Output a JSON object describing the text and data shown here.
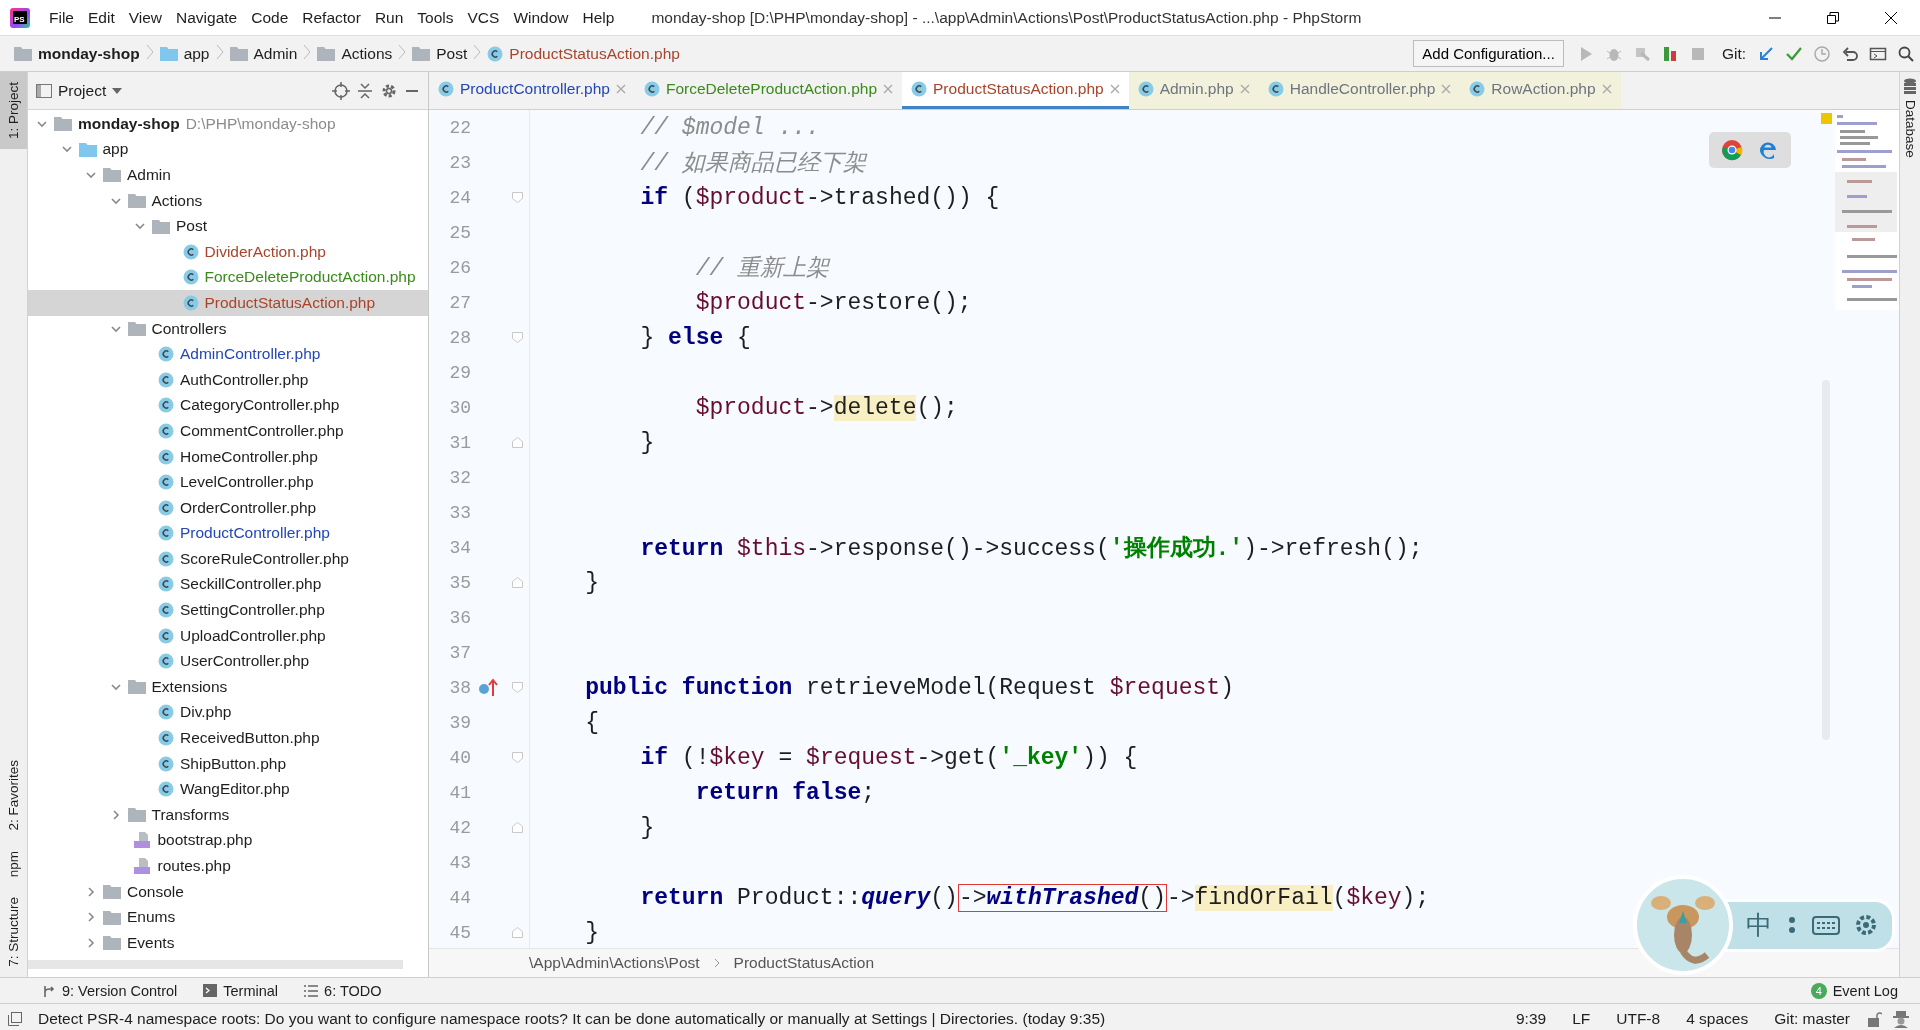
{
  "window": {
    "logo_text": "PS",
    "title": "monday-shop [D:\\PHP\\monday-shop] - ...\\app\\Admin\\Actions\\Post\\ProductStatusAction.php - PhpStorm"
  },
  "menu": [
    "File",
    "Edit",
    "View",
    "Navigate",
    "Code",
    "Refactor",
    "Run",
    "Tools",
    "VCS",
    "Window",
    "Help"
  ],
  "navbar": {
    "crumbs": [
      {
        "label": "monday-shop",
        "kind": "root"
      },
      {
        "label": "app",
        "kind": "source-folder"
      },
      {
        "label": "Admin",
        "kind": "folder"
      },
      {
        "label": "Actions",
        "kind": "folder"
      },
      {
        "label": "Post",
        "kind": "folder"
      },
      {
        "label": "ProductStatusAction.php",
        "kind": "class",
        "color": "#a9442a"
      }
    ],
    "run_config": "Add Configuration...",
    "git_label": "Git:"
  },
  "left_strip": [
    {
      "label": "1: Project",
      "selected": true
    },
    {
      "label": "2: Favorites",
      "selected": false
    },
    {
      "label": "npm",
      "selected": false
    },
    {
      "label": "7: Structure",
      "selected": false
    }
  ],
  "right_strip": [
    {
      "label": "Database"
    }
  ],
  "project": {
    "title": "Project",
    "tree": [
      {
        "label": "monday-shop",
        "path": "D:\\PHP\\monday-shop",
        "kind": "root",
        "expanded": true,
        "selected": false,
        "children": [
          {
            "label": "app",
            "kind": "source-folder",
            "expanded": true,
            "selected": false,
            "children": [
              {
                "label": "Admin",
                "kind": "folder",
                "expanded": true,
                "selected": false,
                "children": [
                  {
                    "label": "Actions",
                    "kind": "folder",
                    "expanded": true,
                    "selected": false,
                    "children": [
                      {
                        "label": "Post",
                        "kind": "folder",
                        "expanded": true,
                        "selected": false,
                        "children": [
                          {
                            "label": "DividerAction.php",
                            "kind": "class",
                            "color": "#a9442a",
                            "selected": false
                          },
                          {
                            "label": "ForceDeleteProductAction.php",
                            "kind": "class",
                            "color": "#3a8a1c",
                            "selected": false
                          },
                          {
                            "label": "ProductStatusAction.php",
                            "kind": "class",
                            "color": "#a9442a",
                            "selected": true
                          }
                        ]
                      }
                    ]
                  },
                  {
                    "label": "Controllers",
                    "kind": "folder",
                    "expanded": true,
                    "selected": false,
                    "children": [
                      {
                        "label": "AdminController.php",
                        "kind": "class",
                        "color": "#2346b8",
                        "selected": false
                      },
                      {
                        "label": "AuthController.php",
                        "kind": "class",
                        "color": "#1e1e1e",
                        "selected": false
                      },
                      {
                        "label": "CategoryController.php",
                        "kind": "class",
                        "color": "#1e1e1e",
                        "selected": false
                      },
                      {
                        "label": "CommentController.php",
                        "kind": "class",
                        "color": "#1e1e1e",
                        "selected": false
                      },
                      {
                        "label": "HomeController.php",
                        "kind": "class",
                        "color": "#1e1e1e",
                        "selected": false
                      },
                      {
                        "label": "LevelController.php",
                        "kind": "class",
                        "color": "#1e1e1e",
                        "selected": false
                      },
                      {
                        "label": "OrderController.php",
                        "kind": "class",
                        "color": "#1e1e1e",
                        "selected": false
                      },
                      {
                        "label": "ProductController.php",
                        "kind": "class",
                        "color": "#2346b8",
                        "selected": false
                      },
                      {
                        "label": "ScoreRuleController.php",
                        "kind": "class",
                        "color": "#1e1e1e",
                        "selected": false
                      },
                      {
                        "label": "SeckillController.php",
                        "kind": "class",
                        "color": "#1e1e1e",
                        "selected": false
                      },
                      {
                        "label": "SettingController.php",
                        "kind": "class",
                        "color": "#1e1e1e",
                        "selected": false
                      },
                      {
                        "label": "UploadController.php",
                        "kind": "class",
                        "color": "#1e1e1e",
                        "selected": false
                      },
                      {
                        "label": "UserController.php",
                        "kind": "class",
                        "color": "#1e1e1e",
                        "selected": false
                      }
                    ]
                  },
                  {
                    "label": "Extensions",
                    "kind": "folder",
                    "expanded": true,
                    "selected": false,
                    "children": [
                      {
                        "label": "Div.php",
                        "kind": "class",
                        "color": "#1e1e1e",
                        "selected": false
                      },
                      {
                        "label": "ReceivedButton.php",
                        "kind": "class",
                        "color": "#1e1e1e",
                        "selected": false
                      },
                      {
                        "label": "ShipButton.php",
                        "kind": "class",
                        "color": "#1e1e1e",
                        "selected": false
                      },
                      {
                        "label": "WangEditor.php",
                        "kind": "class",
                        "color": "#1e1e1e",
                        "selected": false
                      }
                    ]
                  },
                  {
                    "label": "Transforms",
                    "kind": "folder",
                    "expanded": false,
                    "selected": false
                  },
                  {
                    "label": "bootstrap.php",
                    "kind": "php-file",
                    "color": "#1e1e1e",
                    "selected": false
                  },
                  {
                    "label": "routes.php",
                    "kind": "php-file",
                    "color": "#1e1e1e",
                    "selected": false
                  }
                ]
              },
              {
                "label": "Console",
                "kind": "folder",
                "expanded": false,
                "selected": false
              },
              {
                "label": "Enums",
                "kind": "folder",
                "expanded": false,
                "selected": false
              },
              {
                "label": "Events",
                "kind": "folder",
                "expanded": false,
                "selected": false
              }
            ]
          }
        ]
      }
    ]
  },
  "tabs": [
    {
      "label": "ProductController.php",
      "color": "#2346b8",
      "kind": "project",
      "selected": false
    },
    {
      "label": "ForceDeleteProductAction.php",
      "color": "#3a8a1c",
      "kind": "project",
      "selected": false
    },
    {
      "label": "ProductStatusAction.php",
      "color": "#a9442a",
      "kind": "project",
      "selected": true
    },
    {
      "label": "Admin.php",
      "color": "#6f7480",
      "kind": "library",
      "selected": false
    },
    {
      "label": "HandleController.php",
      "color": "#6f7480",
      "kind": "library",
      "selected": false
    },
    {
      "label": "RowAction.php",
      "color": "#6f7480",
      "kind": "library",
      "selected": false
    }
  ],
  "code": [
    {
      "n": "22",
      "tokens": [
        {
          "t": "        // $model ...",
          "kind": "comment"
        }
      ]
    },
    {
      "n": "23",
      "tokens": [
        {
          "t": "        // 如果商品已经下架",
          "kind": "comment"
        }
      ]
    },
    {
      "n": "24",
      "kind": "fold-start",
      "tokens": [
        {
          "t": "        if",
          "kind": "keyword"
        },
        {
          "t": " (",
          "kind": "plain"
        },
        {
          "t": "$product",
          "kind": "variable"
        },
        {
          "t": "->trashed()) {",
          "kind": "plain"
        }
      ]
    },
    {
      "n": "25"
    },
    {
      "n": "26",
      "tokens": [
        {
          "t": "            // 重新上架",
          "kind": "comment"
        }
      ]
    },
    {
      "n": "27",
      "tokens": [
        {
          "t": "            $product",
          "kind": "variable"
        },
        {
          "t": "->restore();",
          "kind": "plain"
        }
      ]
    },
    {
      "n": "28",
      "kind": "fold-start",
      "tokens": [
        {
          "t": "        } ",
          "kind": "plain"
        },
        {
          "t": "else",
          "kind": "keyword"
        },
        {
          "t": " {",
          "kind": "plain"
        }
      ]
    },
    {
      "n": "29"
    },
    {
      "n": "30",
      "tokens": [
        {
          "t": "            $product",
          "kind": "variable"
        },
        {
          "t": "->",
          "kind": "plain"
        },
        {
          "t": "delete",
          "kind": "plain",
          "highlighted": true
        },
        {
          "t": "();",
          "kind": "plain"
        }
      ]
    },
    {
      "n": "31",
      "kind": "fold-end",
      "tokens": [
        {
          "t": "        }",
          "kind": "plain"
        }
      ]
    },
    {
      "n": "32"
    },
    {
      "n": "33"
    },
    {
      "n": "34",
      "tokens": [
        {
          "t": "        return ",
          "kind": "keyword"
        },
        {
          "t": "$this",
          "kind": "variable"
        },
        {
          "t": "->response()->success(",
          "kind": "plain"
        },
        {
          "t": "'操作成功.'",
          "kind": "string"
        },
        {
          "t": ")->refresh();",
          "kind": "plain"
        }
      ]
    },
    {
      "n": "35",
      "kind": "fold-end",
      "tokens": [
        {
          "t": "    }",
          "kind": "plain"
        }
      ]
    },
    {
      "n": "36"
    },
    {
      "n": "37"
    },
    {
      "n": "38",
      "kind": "override",
      "tokens": [
        {
          "t": "    public function",
          "kind": "keyword"
        },
        {
          "t": " retrieveModel(Request ",
          "kind": "plain"
        },
        {
          "t": "$request",
          "kind": "variable"
        },
        {
          "t": ")",
          "kind": "plain"
        }
      ]
    },
    {
      "n": "39",
      "tokens": [
        {
          "t": "    {",
          "kind": "plain"
        }
      ]
    },
    {
      "n": "40",
      "kind": "fold-start",
      "tokens": [
        {
          "t": "        if",
          "kind": "keyword"
        },
        {
          "t": " (!",
          "kind": "plain"
        },
        {
          "t": "$key",
          "kind": "variable"
        },
        {
          "t": " = ",
          "kind": "plain"
        },
        {
          "t": "$request",
          "kind": "variable"
        },
        {
          "t": "->get(",
          "kind": "plain"
        },
        {
          "t": "'_key'",
          "kind": "string"
        },
        {
          "t": ")) {",
          "kind": "plain"
        }
      ]
    },
    {
      "n": "41",
      "tokens": [
        {
          "t": "            return false",
          "kind": "keyword"
        },
        {
          "t": ";",
          "kind": "plain"
        }
      ]
    },
    {
      "n": "42",
      "kind": "fold-end",
      "tokens": [
        {
          "t": "        }",
          "kind": "plain"
        }
      ]
    },
    {
      "n": "43"
    },
    {
      "n": "44",
      "tokens": [
        {
          "t": "        return",
          "kind": "keyword"
        },
        {
          "t": " Product::",
          "kind": "plain"
        },
        {
          "t": "query",
          "kind": "static"
        },
        {
          "t": "()",
          "kind": "plain"
        },
        {
          "t": "->",
          "kind": "plain",
          "boxed": true
        },
        {
          "t": "withTrashed",
          "kind": "static",
          "boxed": true
        },
        {
          "t": "()",
          "kind": "plain",
          "boxed": true
        },
        {
          "t": "->",
          "kind": "plain"
        },
        {
          "t": "findOrFail",
          "kind": "plain",
          "highlighted": true
        },
        {
          "t": "(",
          "kind": "plain"
        },
        {
          "t": "$key",
          "kind": "variable"
        },
        {
          "t": ");",
          "kind": "plain"
        }
      ]
    },
    {
      "n": "45",
      "kind": "fold-end",
      "tokens": [
        {
          "t": "    }",
          "kind": "plain"
        }
      ]
    }
  ],
  "editor_breadcrumb": [
    "\\App\\Admin\\Actions\\Post",
    "ProductStatusAction"
  ],
  "input_method": {
    "mode": "中"
  },
  "tool_windows": [
    {
      "label": "9: Version Control",
      "kind": "vcs"
    },
    {
      "label": "Terminal",
      "kind": "terminal"
    },
    {
      "label": "6: TODO",
      "kind": "todo"
    }
  ],
  "event_log": {
    "count": "4",
    "label": "Event Log"
  },
  "status_bar": {
    "message": "Detect PSR-4 namespace roots: Do you want to configure namespace roots? It can be done automatically or manually at Settings | Directories. (today 9:35)",
    "items": [
      "9:39",
      "LF",
      "UTF-8",
      "4 spaces",
      "Git: master"
    ]
  }
}
